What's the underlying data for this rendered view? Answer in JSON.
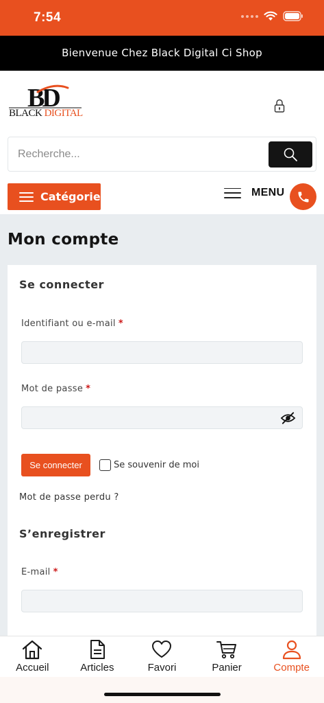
{
  "status_bar": {
    "time": "7:54"
  },
  "banner": {
    "text": "Bienvenue Chez Black Digital Ci Shop"
  },
  "logo": {
    "mark": "BD",
    "word_black": "BLACK",
    "word_digital": " DIGITAL"
  },
  "search": {
    "placeholder": "Recherche..."
  },
  "category_button": {
    "label": "Catégorie"
  },
  "menu": {
    "label": "MENU"
  },
  "account": {
    "title": "Mon compte",
    "login": {
      "heading": "Se connecter",
      "username_label": "Identifiant ou e-mail",
      "password_label": "Mot de passe",
      "required_mark": "*",
      "submit_label": "Se connecter",
      "remember_label": "Se souvenir de moi",
      "lost_password": "Mot de passe perdu ?"
    },
    "register": {
      "heading": "S’enregistrer",
      "email_label": "E-mail",
      "required_mark": "*"
    }
  },
  "bottom_nav": {
    "items": [
      {
        "label": "Accueil",
        "icon": "home-icon"
      },
      {
        "label": "Articles",
        "icon": "document-icon"
      },
      {
        "label": "Favori",
        "icon": "heart-icon"
      },
      {
        "label": "Panier",
        "icon": "cart-icon"
      },
      {
        "label": "Compte",
        "icon": "user-icon",
        "active": true
      }
    ]
  },
  "colors": {
    "accent": "#e8501f",
    "dark": "#141414",
    "background": "#e9edf0",
    "required": "#cc1818"
  }
}
